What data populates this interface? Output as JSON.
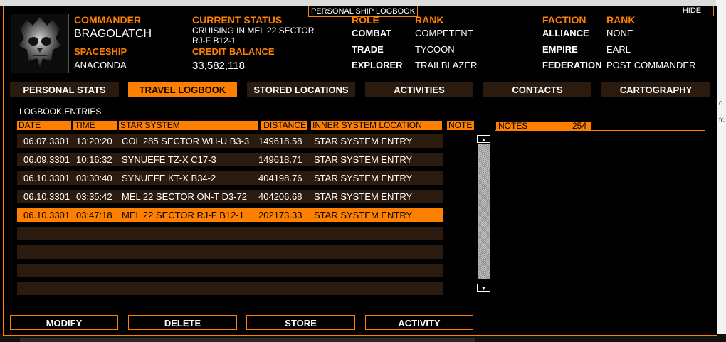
{
  "window": {
    "title": "PERSONAL SHIP LOGBOOK",
    "hide_label": "HIDE"
  },
  "background_right": {
    "line1": "o",
    "line2": "fc"
  },
  "header": {
    "commander_label": "COMMANDER",
    "commander_name": "BRAGOLATCH",
    "spaceship_label": "SPACESHIP",
    "spaceship_name": "ANACONDA",
    "status_label": "CURRENT STATUS",
    "status_value_line1": "CRUISING IN MEL 22 SECTOR",
    "status_value_line2": "RJ-F B12-1",
    "credit_label": "CREDIT BALANCE",
    "credit_value": "33,582,118",
    "role_label": "ROLE",
    "rank_label": "RANK",
    "roles": [
      {
        "role": "COMBAT",
        "rank": "COMPETENT"
      },
      {
        "role": "TRADE",
        "rank": "TYCOON"
      },
      {
        "role": "EXPLORER",
        "rank": "TRAILBLAZER"
      }
    ],
    "faction_label": "FACTION",
    "faction_rank_label": "RANK",
    "factions": [
      {
        "faction": "ALLIANCE",
        "rank": "NONE"
      },
      {
        "faction": "EMPIRE",
        "rank": "EARL"
      },
      {
        "faction": "FEDERATION",
        "rank": "POST COMMANDER"
      }
    ]
  },
  "tabs": [
    {
      "label": "PERSONAL STATS",
      "active": false
    },
    {
      "label": "TRAVEL LOGBOOK",
      "active": true
    },
    {
      "label": "STORED LOCATIONS",
      "active": false
    },
    {
      "label": "ACTIVITIES",
      "active": false
    },
    {
      "label": "CONTACTS",
      "active": false
    },
    {
      "label": "CARTOGRAPHY",
      "active": false
    }
  ],
  "logbook": {
    "title": "LOGBOOK ENTRIES",
    "columns": [
      "DATE",
      "TIME",
      "STAR SYSTEM",
      "DISTANCE",
      "INNER SYSTEM LOCATION",
      "NOTE"
    ],
    "rows": [
      {
        "date": "06.07.3301",
        "time": "13:20:20",
        "system": "COL 285 SECTOR WH-U B3-3",
        "distance": "149618.58",
        "location": "STAR SYSTEM ENTRY",
        "selected": false
      },
      {
        "date": "06.09.3301",
        "time": "10:16:32",
        "system": "SYNUEFE TZ-X C17-3",
        "distance": "149618.71",
        "location": "STAR SYSTEM ENTRY",
        "selected": false
      },
      {
        "date": "06.10.3301",
        "time": "03:30:40",
        "system": "SYNUEFE KT-X B34-2",
        "distance": "404198.76",
        "location": "STAR SYSTEM ENTRY",
        "selected": false
      },
      {
        "date": "06.10.3301",
        "time": "03:35:42",
        "system": "MEL 22 SECTOR ON-T D3-72",
        "distance": "404206.68",
        "location": "STAR SYSTEM ENTRY",
        "selected": false
      },
      {
        "date": "06.10.3301",
        "time": "03:47:18",
        "system": "MEL 22 SECTOR RJ-F B12-1",
        "distance": "202173.33",
        "location": "STAR SYSTEM ENTRY",
        "selected": true
      }
    ],
    "empty_rows": 4
  },
  "notes": {
    "label": "NOTES",
    "count": "254"
  },
  "actions": [
    "MODIFY",
    "DELETE",
    "STORE",
    "ACTIVITY"
  ],
  "icons": {
    "scroll_up": "scroll-up-icon",
    "scroll_down": "scroll-down-icon",
    "avatar": "skull-avatar"
  },
  "colors": {
    "accent": "#ff7f00",
    "row_bg": "#2a1b0e",
    "background": "#000000"
  }
}
